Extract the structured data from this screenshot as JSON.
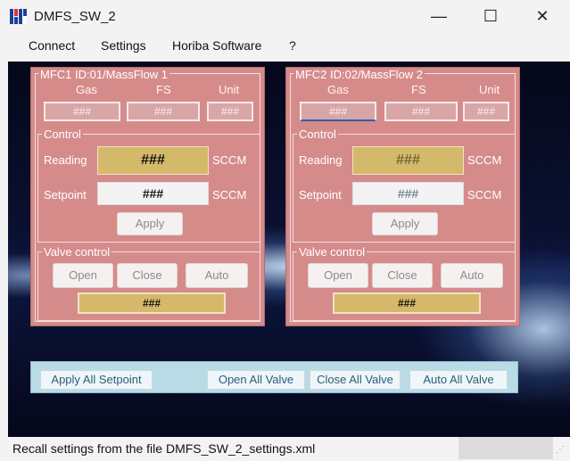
{
  "window": {
    "title": "DMFS_SW_2",
    "minimize": "—",
    "maximize": "☐",
    "close": "✕"
  },
  "menu": [
    "Connect",
    "Settings",
    "Horiba Software",
    "?"
  ],
  "mfcs": [
    {
      "legend": "MFC1  ID:01/MassFlow 1",
      "headers": {
        "gas": "Gas",
        "fs": "FS",
        "unit": "Unit"
      },
      "gas_value": "###",
      "fs_value": "###",
      "unit_value": "###",
      "control_legend": "Control",
      "reading_label": "Reading",
      "reading_value": "###",
      "reading_unit": "SCCM",
      "setpoint_label": "Setpoint",
      "setpoint_value": "###",
      "setpoint_unit": "SCCM",
      "apply_label": "Apply",
      "valve_legend": "Valve control",
      "open_label": "Open",
      "close_label": "Close",
      "auto_label": "Auto",
      "valve_value": "###"
    },
    {
      "legend": "MFC2  ID:02/MassFlow 2",
      "headers": {
        "gas": "Gas",
        "fs": "FS",
        "unit": "Unit"
      },
      "gas_value": "###",
      "fs_value": "###",
      "unit_value": "###",
      "control_legend": "Control",
      "reading_label": "Reading",
      "reading_value": "###",
      "reading_unit": "SCCM",
      "setpoint_label": "Setpoint",
      "setpoint_value": "###",
      "setpoint_unit": "SCCM",
      "apply_label": "Apply",
      "valve_legend": "Valve control",
      "open_label": "Open",
      "close_label": "Close",
      "auto_label": "Auto",
      "valve_value": "###"
    }
  ],
  "bottom": {
    "apply_all": "Apply All Setpoint",
    "open_all": "Open All Valve",
    "close_all": "Close All Valve",
    "auto_all": "Auto All Valve"
  },
  "status": {
    "text": "Recall settings from the file DMFS_SW_2_settings.xml"
  },
  "colors": {
    "panel": "#d68b8b",
    "gold": "#d4b96a",
    "bottom_bar": "#b9dbe6"
  }
}
